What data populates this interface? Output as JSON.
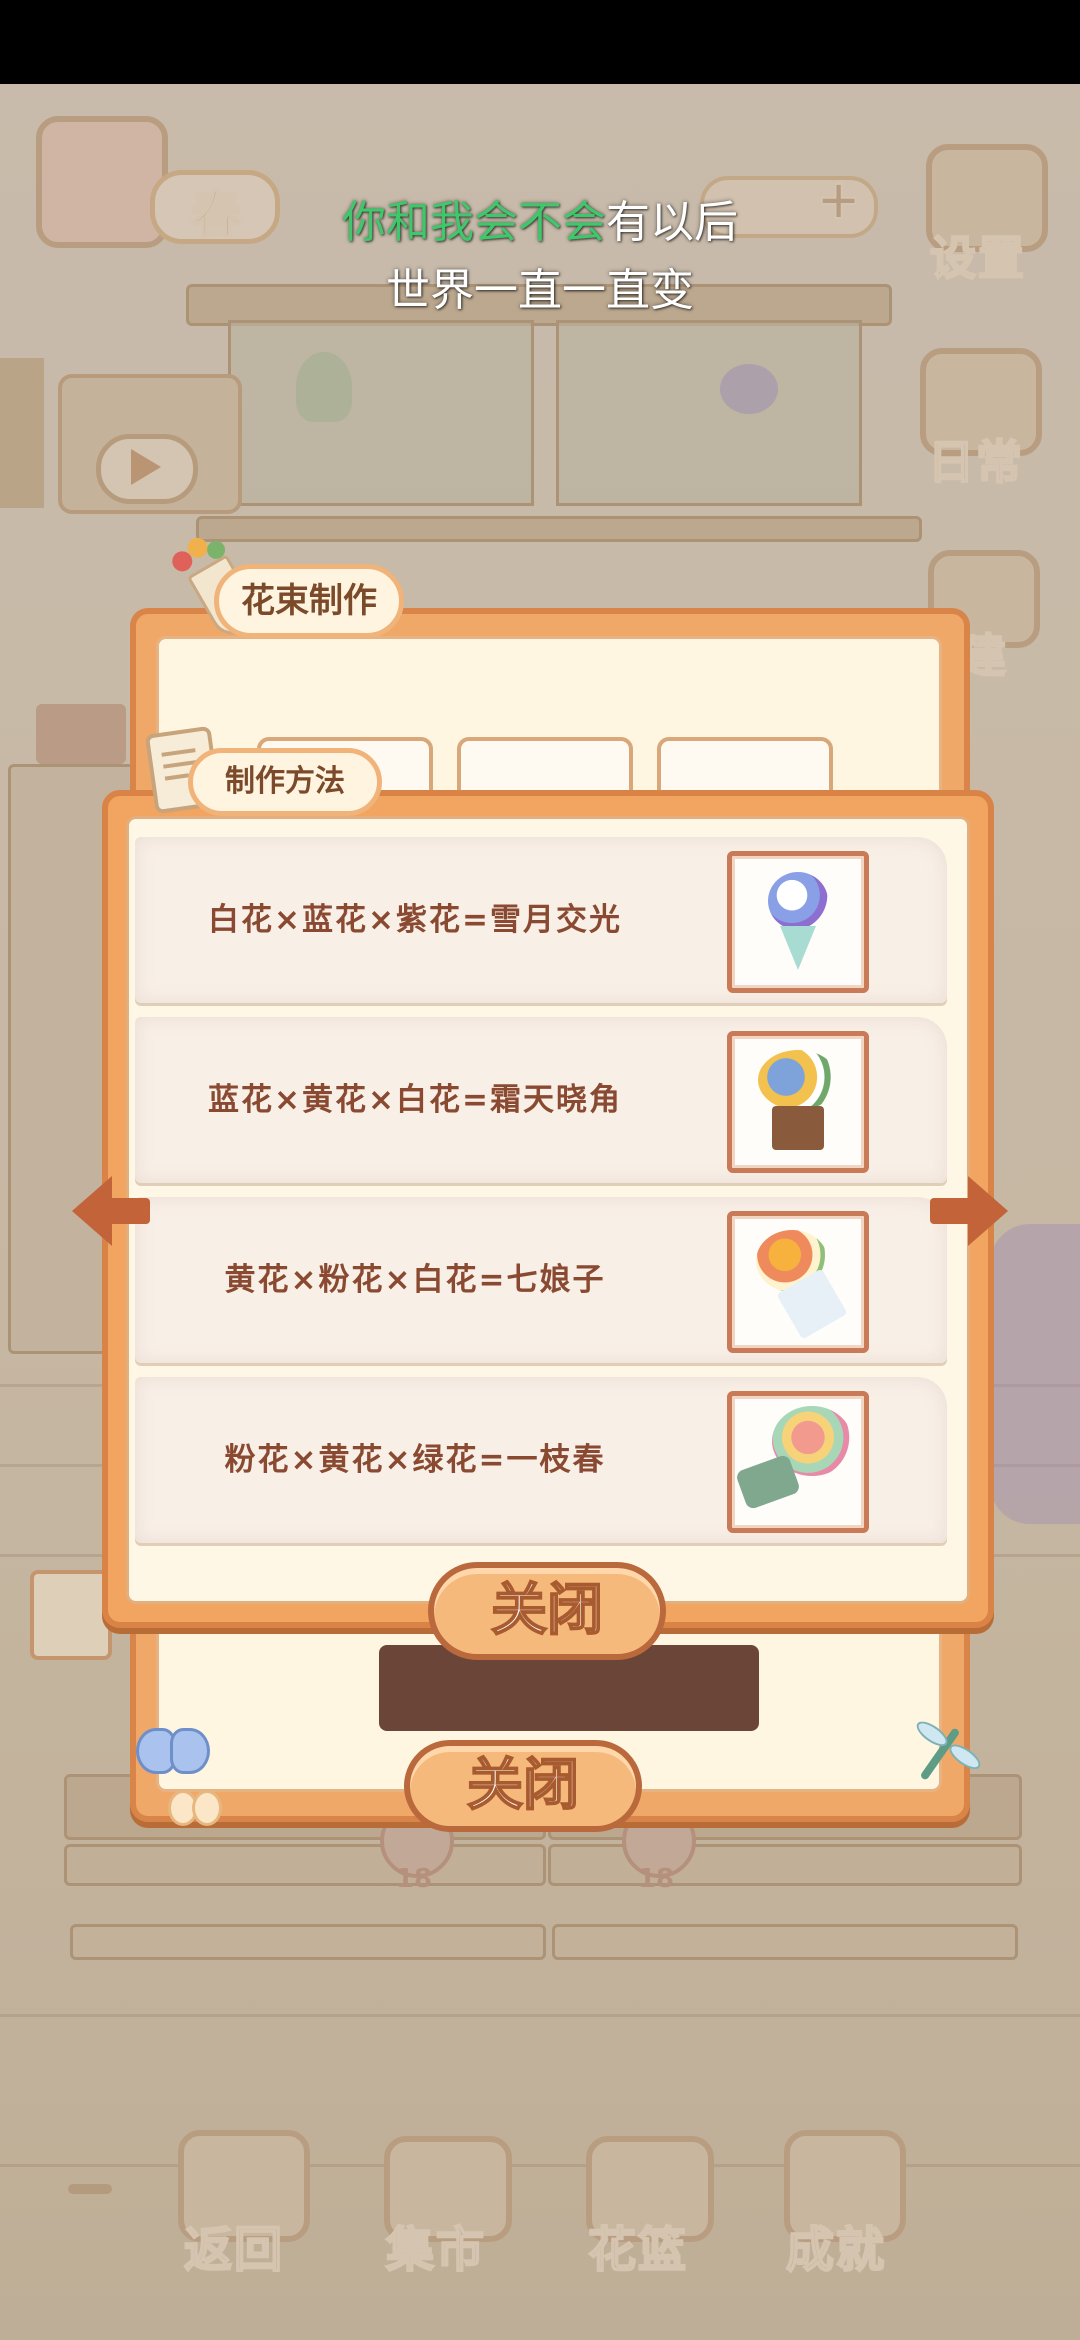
{
  "lyrics": {
    "line1_highlight": "你和我会不会",
    "line1_rest": "有以后",
    "line2": "世界一直一直变"
  },
  "hud": {
    "season_label": "春",
    "settings_label": "设置",
    "daily_label": "日常",
    "build_label": "建",
    "plus_symbol": "+"
  },
  "bouquet_panel": {
    "title": "花束制作",
    "close_label": "关闭"
  },
  "recipe_panel": {
    "title": "制作方法",
    "close_label": "关闭",
    "recipes": [
      {
        "formula": "白花×蓝花×紫花=雪月交光",
        "thumb_icon": "bouquet-white-blue-purple-icon"
      },
      {
        "formula": "蓝花×黄花×白花=霜天晓角",
        "thumb_icon": "bouquet-basket-blue-yellow-icon"
      },
      {
        "formula": "黄花×粉花×白花=七娘子",
        "thumb_icon": "bouquet-yellow-pink-icon"
      },
      {
        "formula": "粉花×黄花×绿花=一枝春",
        "thumb_icon": "bouquet-pink-green-icon"
      }
    ]
  },
  "shop_counts": [
    "18",
    "18"
  ],
  "bottom_nav": [
    {
      "label": "返回",
      "icon": "window-icon"
    },
    {
      "label": "集市",
      "icon": "market-stall-icon"
    },
    {
      "label": "花篮",
      "icon": "flower-basket-icon"
    },
    {
      "label": "成就",
      "icon": "trophy-icon"
    }
  ],
  "colors": {
    "panel_orange": "#f2a461",
    "panel_border": "#d98346",
    "recipe_text": "#8a4a32",
    "lyric_highlight": "#3fc76b"
  }
}
